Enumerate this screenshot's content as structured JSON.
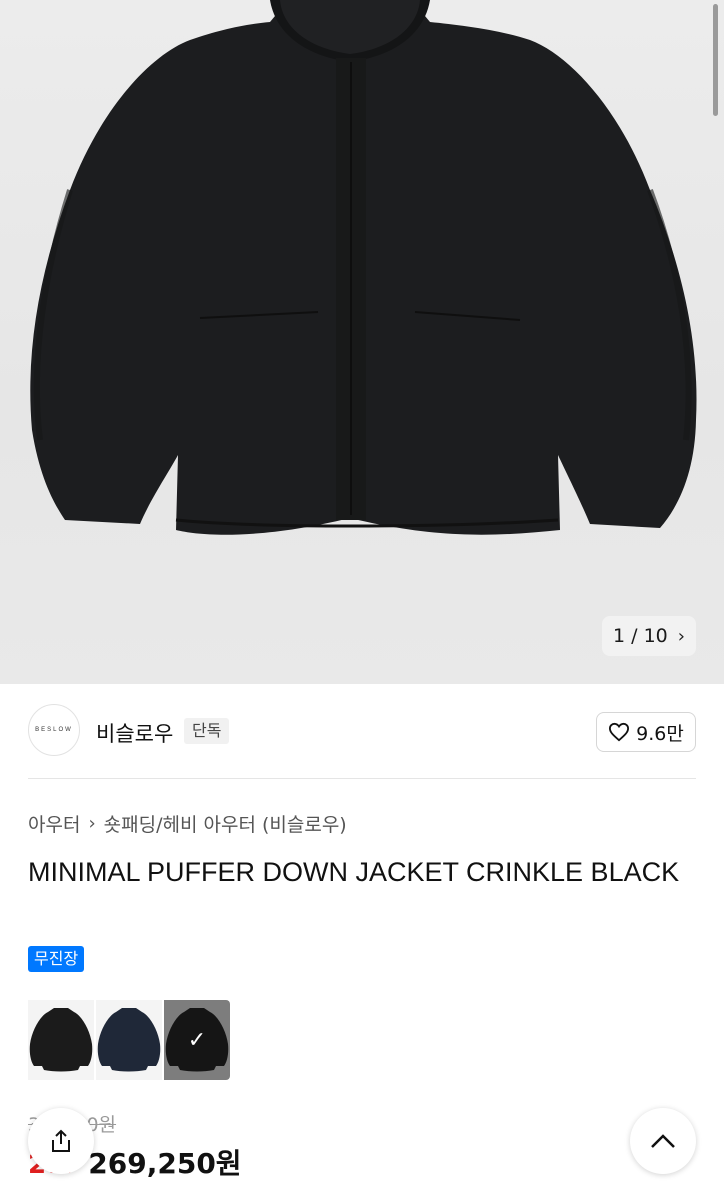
{
  "gallery": {
    "counter_current": "1",
    "counter_sep": "/",
    "counter_total": "10",
    "next_icon": "chevron-right-icon"
  },
  "brand": {
    "logo_text": "BESLOW",
    "name": "비슬로우",
    "badge": "단독",
    "likes": "9.6만"
  },
  "breadcrumb": {
    "level1": "아우터",
    "level2": "숏패딩/헤비 아우터 (비슬로우)"
  },
  "product": {
    "title": "MINIMAL PUFFER DOWN JACKET CRINKLE BLACK",
    "tag": "무진장",
    "original_price": "3??,??0원",
    "discount": "2??",
    "sale_price": "269,250원"
  },
  "swatches": [
    {
      "color": "#1b1b1b",
      "label": "black"
    },
    {
      "color": "#1f2838",
      "label": "navy"
    },
    {
      "color": "#151515",
      "label": "black-crinkle",
      "selected": true
    }
  ],
  "colors": {
    "accent": "#0078ff",
    "discount": "#e02020"
  }
}
